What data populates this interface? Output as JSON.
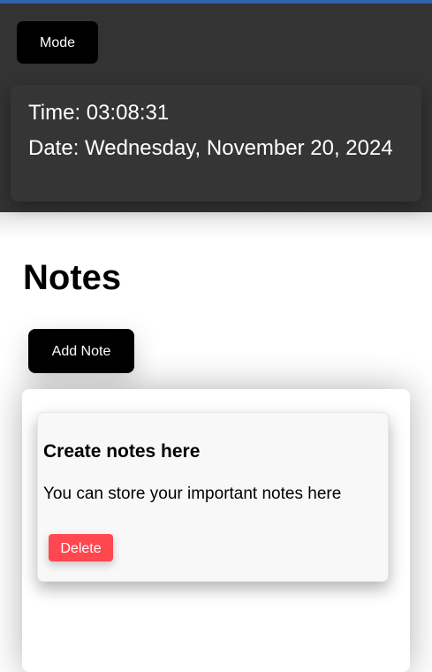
{
  "header": {
    "mode_label": "Mode",
    "time_text": "Time: 03:08:31",
    "date_text": "Date: Wednesday, November 20, 2024"
  },
  "main": {
    "title": "Notes",
    "add_note_label": "Add Note",
    "notes": [
      {
        "title": "Create notes here",
        "body": "You can store your important notes here",
        "delete_label": "Delete"
      }
    ]
  },
  "colors": {
    "topline": "#2f63a8",
    "header_bg": "#333333",
    "button_bg": "#000000",
    "delete_bg": "#ff474f"
  }
}
